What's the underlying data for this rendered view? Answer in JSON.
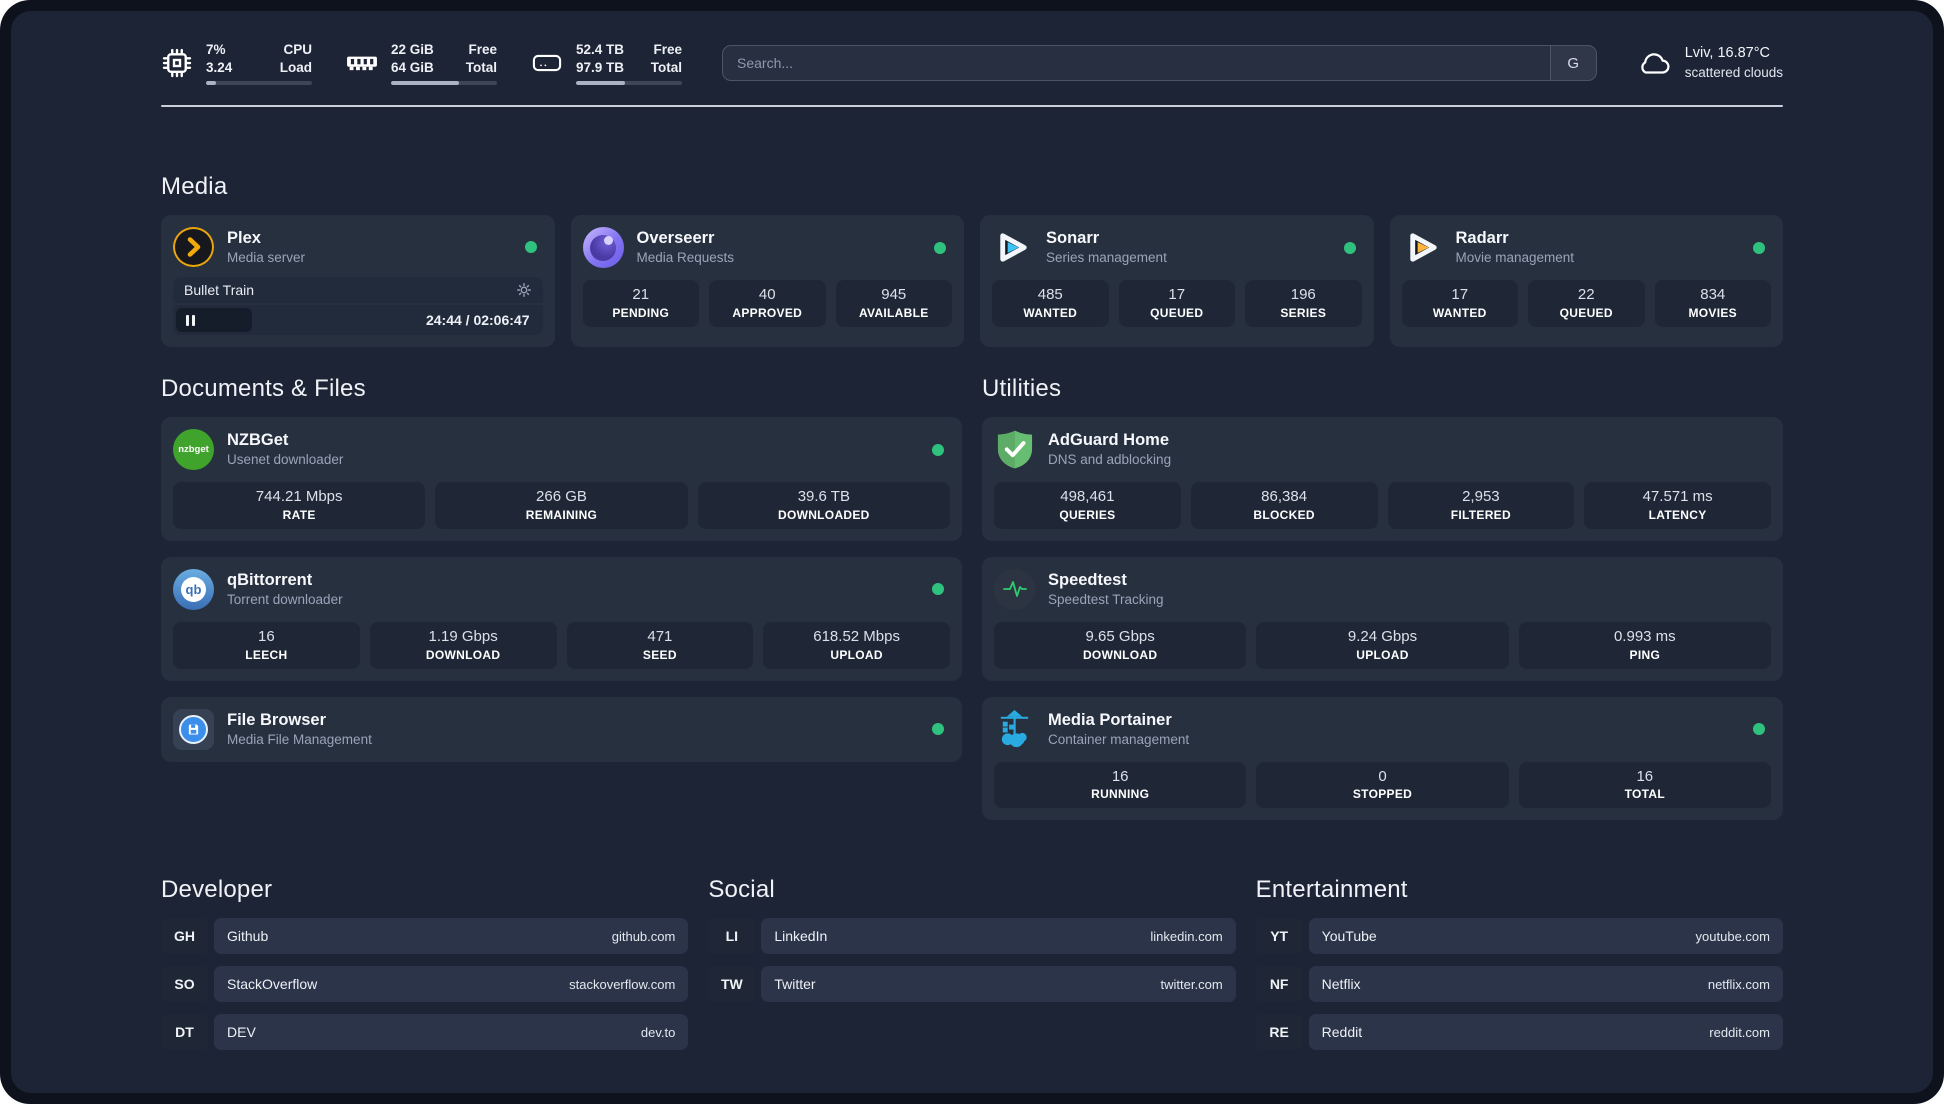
{
  "colors": {
    "page_bg": "#1d2435",
    "frame_bg": "#0e121c",
    "card_bg": "#27303f",
    "tile_bg": "#1f2736",
    "status_online": "#2ec27e",
    "plex_amber": "#e8a50c",
    "sonarr_cyan": "#3fc3f7",
    "radarr_orange": "#ffb53c",
    "adguard_green": "#67bd71",
    "portainer_blue": "#29abe2"
  },
  "header": {
    "cpu": {
      "top_value": "7%",
      "bottom_value": "3.24",
      "top_label": "CPU",
      "bottom_label": "Load",
      "progress_pct": 9
    },
    "memory": {
      "top_value": "22 GiB",
      "bottom_value": "64 GiB",
      "top_label": "Free",
      "bottom_label": "Total",
      "progress_pct": 64
    },
    "storage": {
      "top_value": "52.4 TB",
      "bottom_value": "97.9 TB",
      "top_label": "Free",
      "bottom_label": "Total",
      "progress_pct": 46
    },
    "search": {
      "placeholder": "Search...",
      "engine_label": "G"
    },
    "weather": {
      "location_temp": "Lviv, 16.87°C",
      "condition": "scattered clouds"
    }
  },
  "media": {
    "section_title": "Media",
    "plex": {
      "title": "Plex",
      "subtitle": "Media server",
      "now_playing": "Bullet Train",
      "time": "24:44 / 02:06:47",
      "progress_pct": 21
    },
    "overseerr": {
      "title": "Overseerr",
      "subtitle": "Media Requests",
      "stats": [
        {
          "value": "21",
          "label": "PENDING"
        },
        {
          "value": "40",
          "label": "APPROVED"
        },
        {
          "value": "945",
          "label": "AVAILABLE"
        }
      ]
    },
    "sonarr": {
      "title": "Sonarr",
      "subtitle": "Series management",
      "stats": [
        {
          "value": "485",
          "label": "WANTED"
        },
        {
          "value": "17",
          "label": "QUEUED"
        },
        {
          "value": "196",
          "label": "SERIES"
        }
      ]
    },
    "radarr": {
      "title": "Radarr",
      "subtitle": "Movie management",
      "stats": [
        {
          "value": "17",
          "label": "WANTED"
        },
        {
          "value": "22",
          "label": "QUEUED"
        },
        {
          "value": "834",
          "label": "MOVIES"
        }
      ]
    }
  },
  "documents": {
    "section_title": "Documents & Files",
    "nzbget": {
      "title": "NZBGet",
      "subtitle": "Usenet downloader",
      "icon_text": "nzbget",
      "stats": [
        {
          "value": "744.21 Mbps",
          "label": "RATE"
        },
        {
          "value": "266 GB",
          "label": "REMAINING"
        },
        {
          "value": "39.6 TB",
          "label": "DOWNLOADED"
        }
      ]
    },
    "qbittorrent": {
      "title": "qBittorrent",
      "subtitle": "Torrent downloader",
      "icon_text": "qb",
      "stats": [
        {
          "value": "16",
          "label": "LEECH"
        },
        {
          "value": "1.19 Gbps",
          "label": "DOWNLOAD"
        },
        {
          "value": "471",
          "label": "SEED"
        },
        {
          "value": "618.52 Mbps",
          "label": "UPLOAD"
        }
      ]
    },
    "filebrowser": {
      "title": "File Browser",
      "subtitle": "Media File Management"
    }
  },
  "utilities": {
    "section_title": "Utilities",
    "adguard": {
      "title": "AdGuard Home",
      "subtitle": "DNS and adblocking",
      "stats": [
        {
          "value": "498,461",
          "label": "QUERIES"
        },
        {
          "value": "86,384",
          "label": "BLOCKED"
        },
        {
          "value": "2,953",
          "label": "FILTERED"
        },
        {
          "value": "47.571 ms",
          "label": "LATENCY"
        }
      ]
    },
    "speedtest": {
      "title": "Speedtest",
      "subtitle": "Speedtest Tracking",
      "stats": [
        {
          "value": "9.65 Gbps",
          "label": "DOWNLOAD"
        },
        {
          "value": "9.24 Gbps",
          "label": "UPLOAD"
        },
        {
          "value": "0.993 ms",
          "label": "PING"
        }
      ]
    },
    "portainer": {
      "title": "Media Portainer",
      "subtitle": "Container management",
      "stats": [
        {
          "value": "16",
          "label": "RUNNING"
        },
        {
          "value": "0",
          "label": "STOPPED"
        },
        {
          "value": "16",
          "label": "TOTAL"
        }
      ]
    }
  },
  "bookmarks": [
    {
      "title": "Developer",
      "items": [
        {
          "abbr": "GH",
          "name": "Github",
          "url": "github.com"
        },
        {
          "abbr": "SO",
          "name": "StackOverflow",
          "url": "stackoverflow.com"
        },
        {
          "abbr": "DT",
          "name": "DEV",
          "url": "dev.to"
        }
      ]
    },
    {
      "title": "Social",
      "items": [
        {
          "abbr": "LI",
          "name": "LinkedIn",
          "url": "linkedin.com"
        },
        {
          "abbr": "TW",
          "name": "Twitter",
          "url": "twitter.com"
        }
      ]
    },
    {
      "title": "Entertainment",
      "items": [
        {
          "abbr": "YT",
          "name": "YouTube",
          "url": "youtube.com"
        },
        {
          "abbr": "NF",
          "name": "Netflix",
          "url": "netflix.com"
        },
        {
          "abbr": "RE",
          "name": "Reddit",
          "url": "reddit.com"
        }
      ]
    }
  ]
}
